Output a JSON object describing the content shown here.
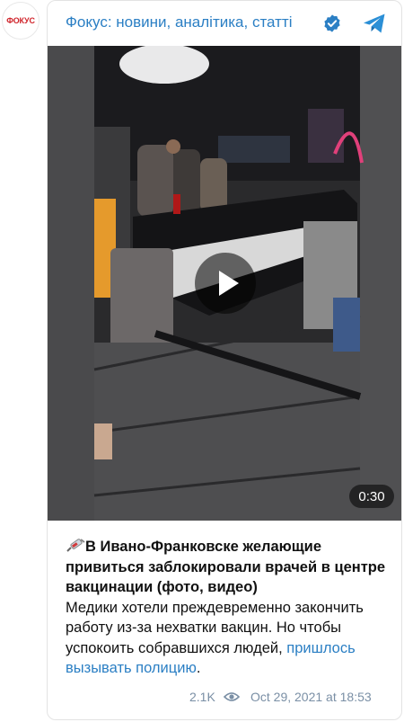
{
  "channel": {
    "avatar_text": "ФОКУС",
    "title": "Фокус: новини, аналітика, статті"
  },
  "video": {
    "duration": "0:30"
  },
  "post": {
    "headline": "В Ивано-Франковске желающие привиться заблокировали врачей в центре вакцинации (фото, видео)",
    "body": "Медики хотели преждевременно закончить работу из-за нехватки вакцин. Но чтобы успокоить собравшихся людей, ",
    "link_text": "пришлось вызывать полицию",
    "tail": "."
  },
  "footer": {
    "views": "2.1K",
    "date": "Oct 29, 2021 at 18:53"
  },
  "colors": {
    "link": "#2b7fc4",
    "brand": "#d0242b",
    "meta": "#7a8fa5"
  },
  "icons": [
    "verified-icon",
    "telegram-icon",
    "syringe-icon",
    "eye-icon",
    "play-icon"
  ]
}
